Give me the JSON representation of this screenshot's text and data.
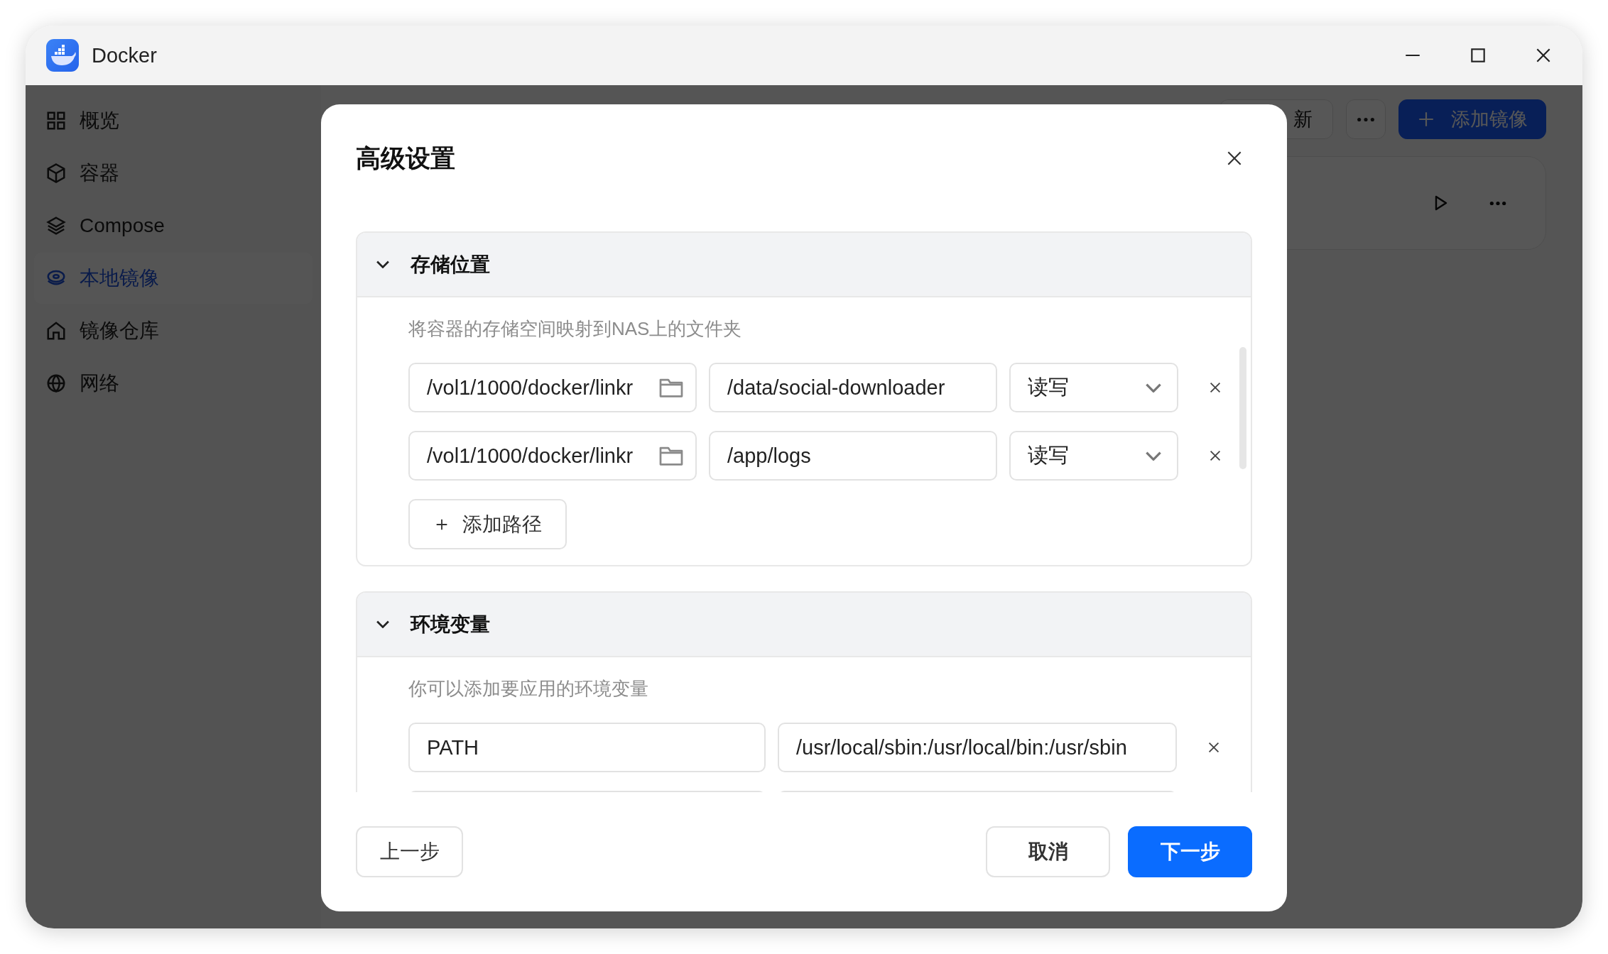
{
  "window": {
    "title": "Docker"
  },
  "sidebar": {
    "items": [
      {
        "label": "概览",
        "kind": "grid",
        "selected": false
      },
      {
        "label": "容器",
        "kind": "cube",
        "selected": false
      },
      {
        "label": "Compose",
        "kind": "layers",
        "selected": false
      },
      {
        "label": "本地镜像",
        "kind": "disc",
        "selected": true
      },
      {
        "label": "镜像仓库",
        "kind": "house",
        "selected": false
      },
      {
        "label": "网络",
        "kind": "globe",
        "selected": false
      }
    ]
  },
  "toolbar": {
    "buttons": [
      {
        "kind": "refresh",
        "label": "新"
      },
      {
        "kind": "more"
      },
      {
        "kind": "primary",
        "label": "添加镜像"
      }
    ]
  },
  "dialog": {
    "title": "高级设置",
    "sections": [
      {
        "kind": "volumes",
        "title": "存储位置",
        "expanded": true,
        "description": "将容器的存储空间映射到NAS上的文件夹",
        "rows": [
          {
            "host": "/vol1/1000/docker/linkr",
            "container": "/data/social-downloader",
            "mode": "读写"
          },
          {
            "host": "/vol1/1000/docker/linkr",
            "container": "/app/logs",
            "mode": "读写"
          }
        ],
        "add_button": "添加路径"
      },
      {
        "kind": "env",
        "title": "环境变量",
        "expanded": true,
        "description": "你可以添加要应用的环境变量",
        "rows": [
          {
            "key": "PATH",
            "value": "/usr/local/sbin:/usr/local/bin:/usr/sbin"
          },
          {}
        ]
      }
    ],
    "buttons": {
      "back": "上一步",
      "cancel": "取消",
      "next": "下一步"
    }
  }
}
